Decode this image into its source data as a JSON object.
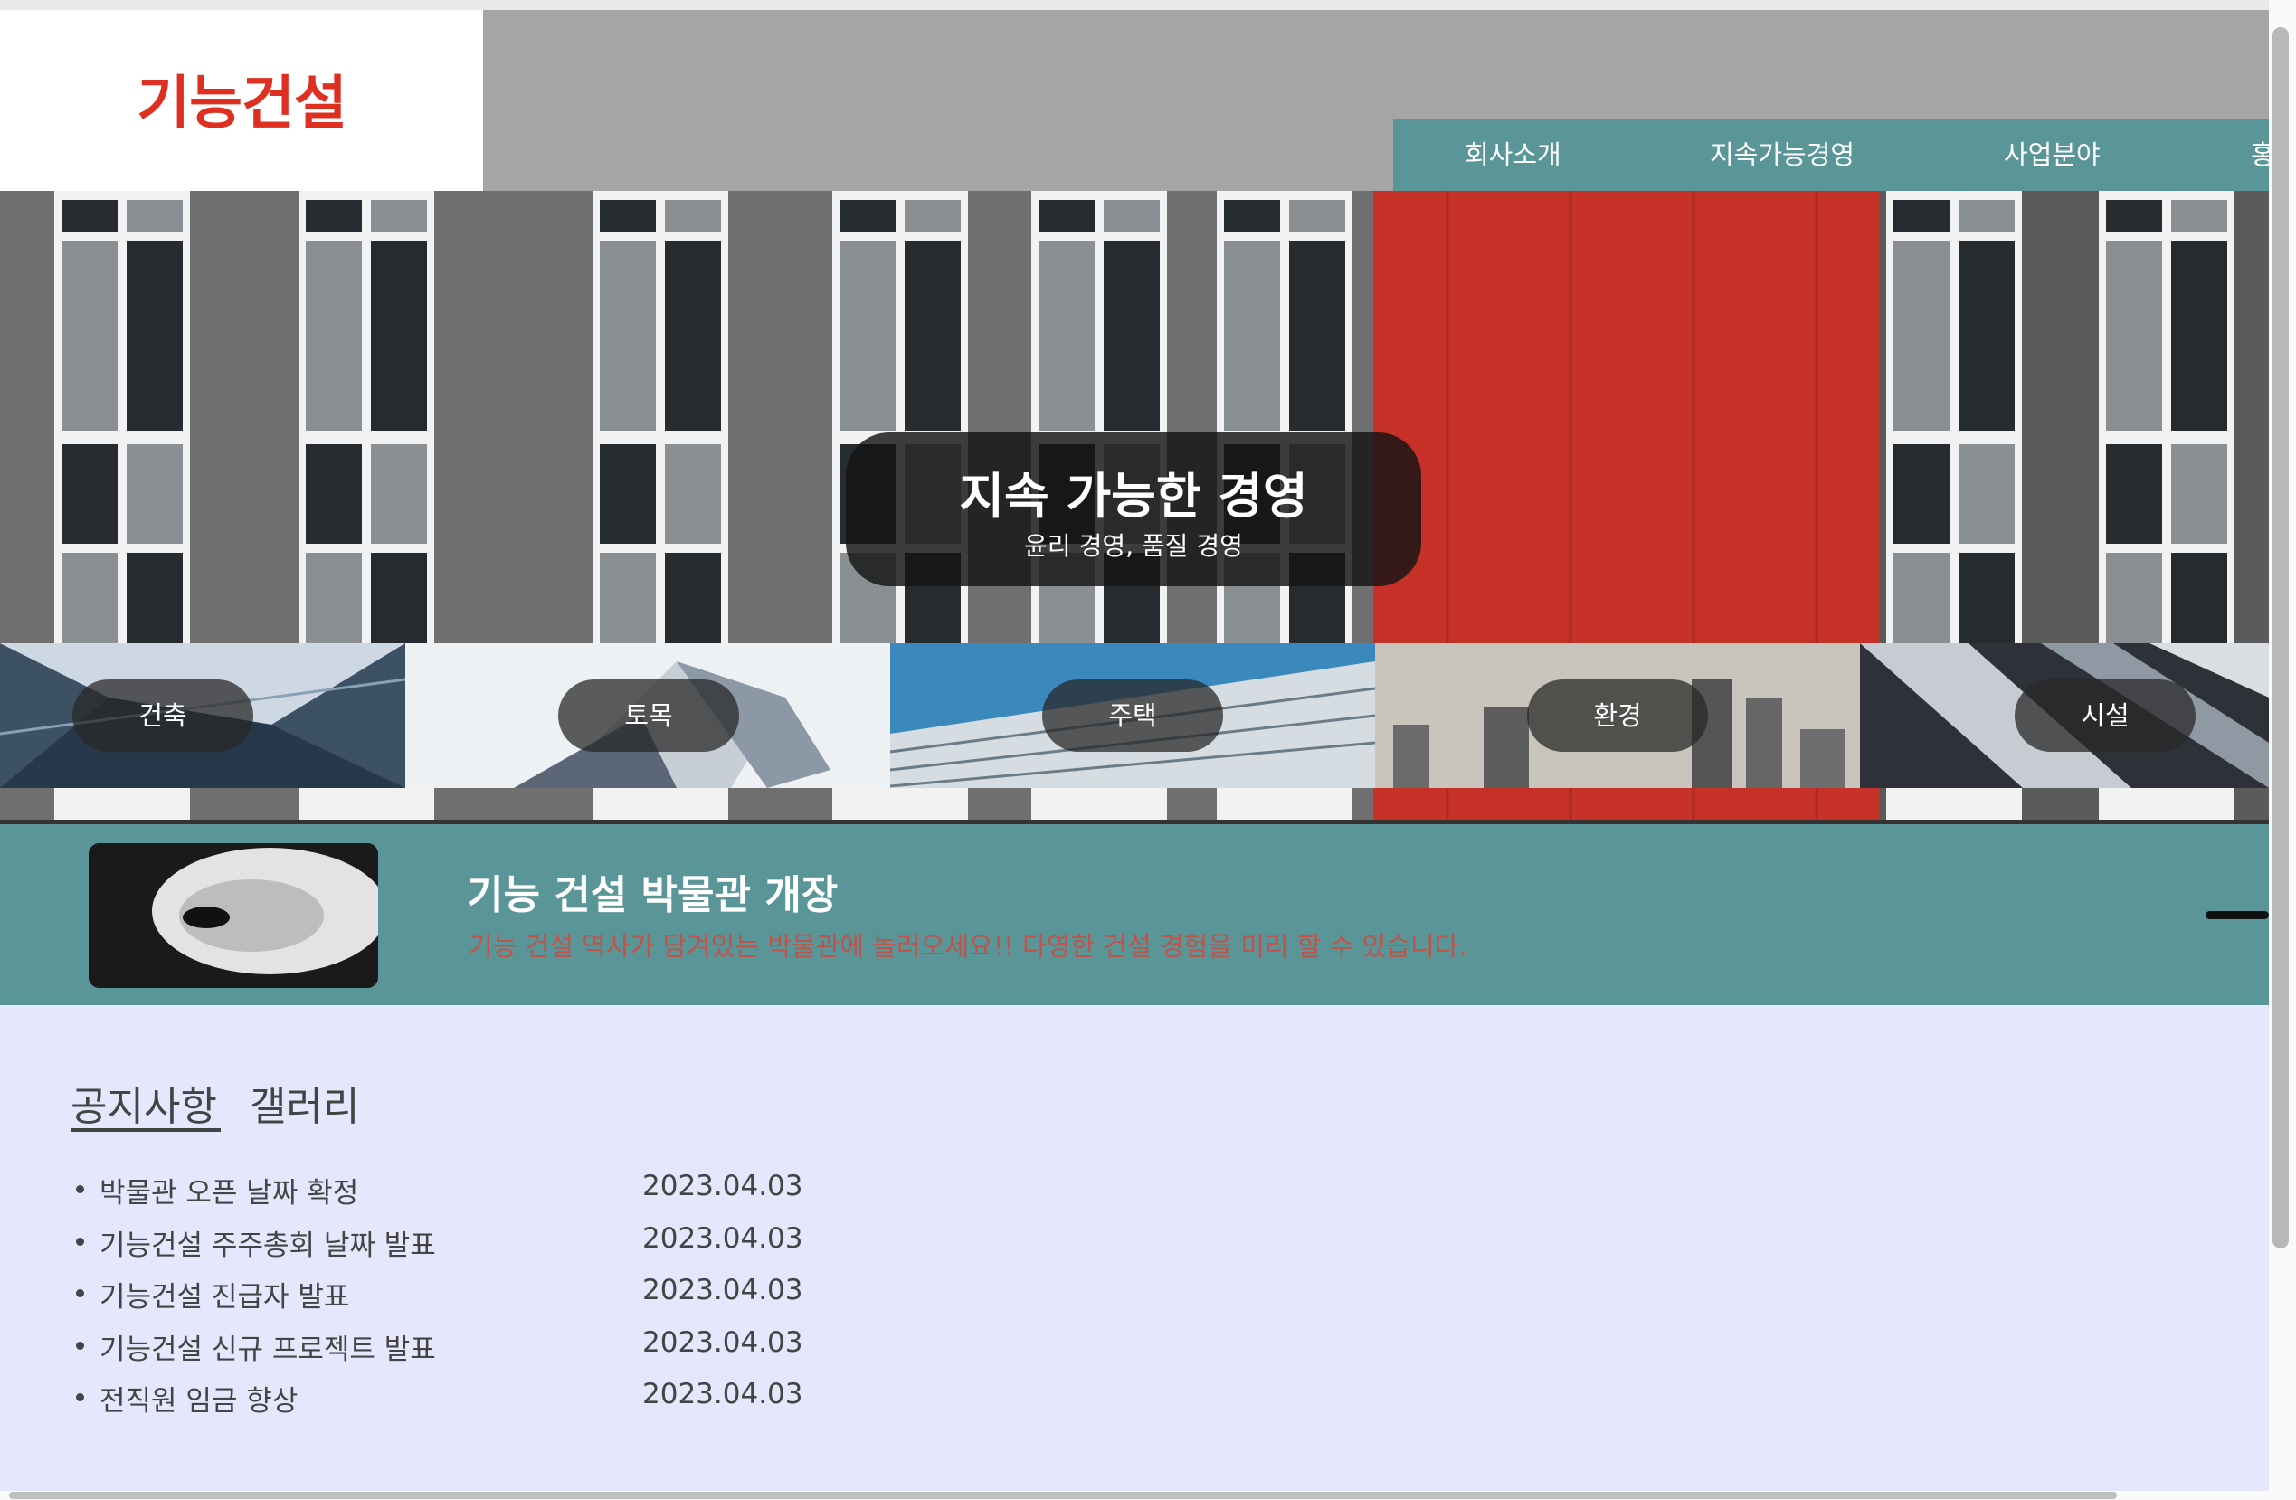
{
  "header": {
    "logo": "기능건설",
    "nav": [
      {
        "label": "회사소개"
      },
      {
        "label": "지속가능경영"
      },
      {
        "label": "사업분야"
      },
      {
        "label": "홍"
      }
    ]
  },
  "hero": {
    "title": "지속 가능한 경영",
    "subtitle": "윤리 경영, 품질 경영",
    "categories": [
      {
        "label": "건축",
        "icon": "building-photo"
      },
      {
        "label": "토목",
        "icon": "civil-photo"
      },
      {
        "label": "주택",
        "icon": "housing-photo"
      },
      {
        "label": "환경",
        "icon": "environment-photo"
      },
      {
        "label": "시설",
        "icon": "facility-photo"
      }
    ]
  },
  "banner": {
    "title": "기능 건설 박물관 개장",
    "subtitle": "기능 건설 역사가 담겨있는 박물관에 놀러오세요!! 다영한 건설 경험을 미리 할 수 있습니다."
  },
  "board": {
    "tabs": [
      {
        "label": "공지사항",
        "active": true
      },
      {
        "label": "갤러리",
        "active": false
      }
    ],
    "notices": [
      {
        "title": "박물관 오픈 날짜 확정",
        "date": "2023.04.03"
      },
      {
        "title": "기능건설 주주총회 날짜 발표",
        "date": "2023.04.03"
      },
      {
        "title": "기능건설 진급자 발표",
        "date": "2023.04.03"
      },
      {
        "title": "기능건설 신규 프로젝트 발표",
        "date": "2023.04.03"
      },
      {
        "title": "전직원 임금 향상",
        "date": "2023.04.03"
      }
    ]
  },
  "colors": {
    "brand_red": "#dd3020",
    "teal": "#5a9597",
    "content_bg": "#e5e8fd",
    "header_gray": "#a5a5a5"
  }
}
